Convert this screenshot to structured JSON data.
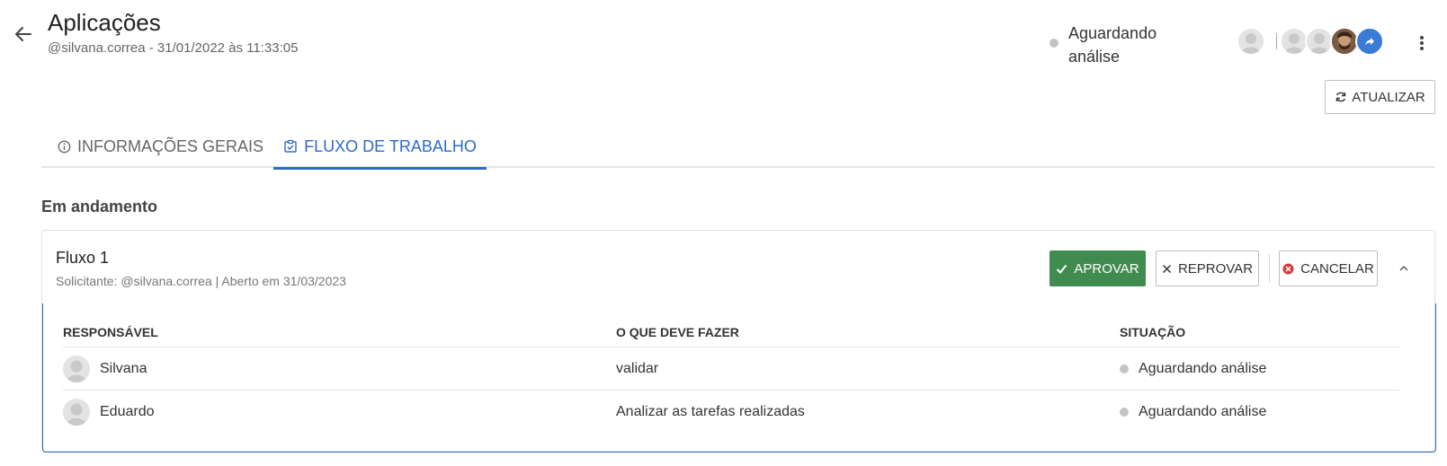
{
  "header": {
    "title": "Aplicações",
    "subtitle": "@silvana.correa - 31/01/2022 às 11:33:05",
    "status": "Aguardando análise",
    "status_color": "#c4c4c4"
  },
  "actions": {
    "refresh_label": "ATUALIZAR"
  },
  "tabs": [
    {
      "label": "INFORMAÇÕES GERAIS",
      "icon": "info-icon",
      "active": false
    },
    {
      "label": "FLUXO DE TRABALHO",
      "icon": "clipboard-check-icon",
      "active": true
    }
  ],
  "section": {
    "title": "Em andamento"
  },
  "flow": {
    "title": "Fluxo 1",
    "subtitle": "Solicitante: @silvana.correa | Aberto em 31/03/2023",
    "approve_label": "APROVAR",
    "reject_label": "REPROVAR",
    "cancel_label": "CANCELAR",
    "columns": [
      "RESPONSÁVEL",
      "O QUE DEVE FAZER",
      "SITUAÇÃO"
    ],
    "rows": [
      {
        "name": "Silvana",
        "task": "validar",
        "status": "Aguardando análise"
      },
      {
        "name": "Eduardo",
        "task": "Analizar as tarefas realizadas",
        "status": "Aguardando análise"
      }
    ]
  },
  "colors": {
    "accent": "#2d6bc9",
    "approve": "#3f8c4e",
    "cancel_icon": "#d63b3b"
  }
}
